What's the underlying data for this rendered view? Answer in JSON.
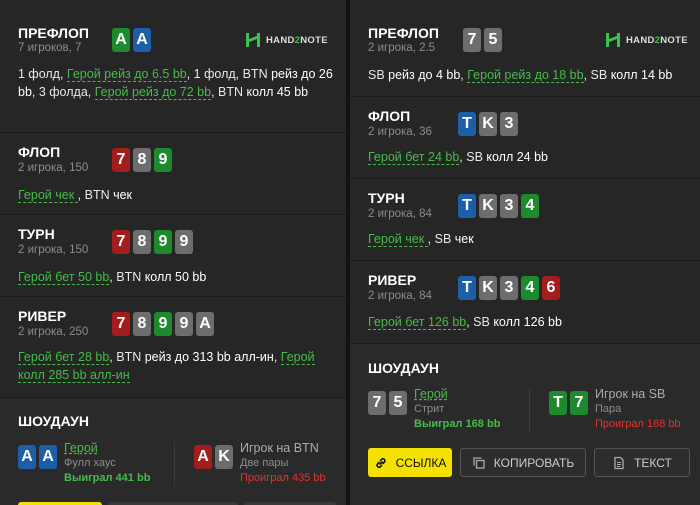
{
  "left": {
    "preflop": {
      "title": "ПРЕФЛОП",
      "sub": "7 игроков, 7",
      "cards": [
        "A",
        "A"
      ],
      "a1": "1 фолд, ",
      "a2": "Герой рейз до 6.5 bb",
      "a3": ", 1 фолд, BTN ",
      "a4": "рейз до",
      "a5": " 26 bb",
      "a6": ", 3 фолда, ",
      "a7": "Герой рейз до 72 bb",
      "a8": ", BTN ",
      "a9": "колл 45 bb"
    },
    "flop": {
      "title": "ФЛОП",
      "sub": "2 игрока, 150",
      "cards": [
        "7",
        "8",
        "9"
      ],
      "a1": "Герой чек ",
      "a2": ", BTN ",
      "a3": "чек"
    },
    "turn": {
      "title": "ТУРН",
      "sub": "2 игрока, 150",
      "cards": [
        "7",
        "8",
        "9",
        "9"
      ],
      "a1": "Герой бет 50 bb",
      "a2": ", BTN ",
      "a3": "колл 50 bb"
    },
    "river": {
      "title": "РИВЕР",
      "sub": "2 игрока, 250",
      "cards": [
        "7",
        "8",
        "9",
        "9",
        "A"
      ],
      "a1": "Герой бет 28 bb",
      "a2": ", BTN ",
      "a3": "рейз до 313 bb алл-ин",
      "a4": ", ",
      "a5": "Герой",
      "a6": "колл 285 bb алл-ин"
    },
    "showdown": {
      "title": "ШОУДАУН",
      "hero_cards": [
        "A",
        "A"
      ],
      "hero": "Герой",
      "hero_hand": "Фулл хаус",
      "hero_result": "Выиграл 441 bb",
      "opp_cards": [
        "A",
        "K"
      ],
      "opp": "Игрок на BTN",
      "opp_hand": "Две пары",
      "opp_result": "Проиграл 435 bb"
    }
  },
  "right": {
    "preflop": {
      "title": "ПРЕФЛОП",
      "sub": "2 игрока, 2.5",
      "cards": [
        "7",
        "5"
      ],
      "a1": "SB ",
      "a2": "рейз до 4 bb",
      "a3": ", ",
      "a4": "Герой рейз до 18 bb",
      "a5": ", SB ",
      "a6": "колл 14 bb"
    },
    "flop": {
      "title": "ФЛОП",
      "sub": "2 игрока, 36",
      "cards": [
        "T",
        "K",
        "3"
      ],
      "a1": "Герой бет 24 bb",
      "a2": ", SB ",
      "a3": "колл 24 bb"
    },
    "turn": {
      "title": "ТУРН",
      "sub": "2 игрока, 84",
      "cards": [
        "T",
        "K",
        "3",
        "4"
      ],
      "a1": "Герой чек ",
      "a2": ", SB ",
      "a3": "чек"
    },
    "river": {
      "title": "РИВЕР",
      "sub": "2 игрока, 84",
      "cards": [
        "T",
        "K",
        "3",
        "4",
        "6"
      ],
      "a1": "Герой бет 126 bb",
      "a2": ", SB ",
      "a3": "колл 126 bb"
    },
    "showdown": {
      "title": "ШОУДАУН",
      "hero_cards": [
        "7",
        "5"
      ],
      "hero": "Герой",
      "hero_hand": "Стрит",
      "hero_result": "Выиграл 168 bb",
      "opp_cards": [
        "T",
        "7"
      ],
      "opp": "Игрок на SB",
      "opp_hand": "Пара",
      "opp_result": "Проиграл 168 bb"
    },
    "buttons": {
      "link": "ССЫЛКА",
      "copy": "КОПИРОВАТЬ",
      "text": "ТЕКСТ"
    }
  },
  "logo": {
    "part1": "HAND",
    "part2": "2",
    "part3": "NOTE"
  },
  "colors": {
    "hero": "#46bb4a",
    "win": "#46bb4a",
    "loss": "#e03333",
    "btn_accent": "#f4e100",
    "card_green": "#1e8a2e",
    "card_blue": "#1c5ea8",
    "card_red": "#a31d1d",
    "card_gray": "#6d6d6d"
  },
  "icons": {
    "logo": "hand2note-logo-icon",
    "link": "link-icon",
    "copy": "copy-icon",
    "text": "document-icon"
  }
}
